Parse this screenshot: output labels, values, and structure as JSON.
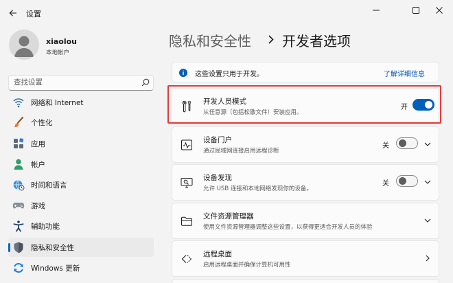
{
  "window": {
    "title": "设置",
    "buttons": [
      "minimize-icon",
      "maximize-icon",
      "close-icon"
    ]
  },
  "profile": {
    "name": "xiaolou",
    "account_type": "本地帐户"
  },
  "search": {
    "placeholder": "查找设置"
  },
  "sidebar": {
    "items": [
      {
        "label": "网络和 Internet",
        "icon": "network-icon"
      },
      {
        "label": "个性化",
        "icon": "brush-icon"
      },
      {
        "label": "应用",
        "icon": "apps-icon"
      },
      {
        "label": "帐户",
        "icon": "account-icon"
      },
      {
        "label": "时间和语言",
        "icon": "globe-clock-icon"
      },
      {
        "label": "游戏",
        "icon": "gamepad-icon"
      },
      {
        "label": "辅助功能",
        "icon": "accessibility-icon"
      },
      {
        "label": "隐私和安全性",
        "icon": "shield-icon",
        "selected": true
      },
      {
        "label": "Windows 更新",
        "icon": "update-icon"
      }
    ]
  },
  "header": {
    "parent": "隐私和安全性",
    "separator": "›",
    "current": "开发者选项"
  },
  "info_bar": {
    "text": "这些设置只用于开发。",
    "link": "了解详细信息"
  },
  "settings": [
    {
      "title": "开发人员模式",
      "desc": "从任意源（包括松散文件）安装应用。",
      "state": "开",
      "toggle_on": true,
      "expandable": false,
      "icon": "developer-tools-icon",
      "highlighted": true
    },
    {
      "title": "设备门户",
      "desc": "通过局域网连接启用远程诊断",
      "state": "关",
      "toggle_on": false,
      "expandable": true,
      "icon": "device-portal-icon"
    },
    {
      "title": "设备发现",
      "desc": "允许 USB 连接和本地网络发现你的设备。",
      "state": "关",
      "toggle_on": false,
      "expandable": true,
      "icon": "device-discovery-icon"
    },
    {
      "title": "文件资源管理器",
      "desc": "使用文件资源管理器调整这些设置，以获得更适合开发人员的体验",
      "expandable": true,
      "icon": "folder-icon"
    },
    {
      "title": "远程桌面",
      "desc": "启用远程桌面并确保计算机可用性",
      "navigate": true,
      "icon": "remote-desktop-icon"
    }
  ],
  "colors": {
    "accent": "#005fb8",
    "highlight_border": "#e03c3c",
    "link": "#0058b0",
    "background": "#f3f3f3",
    "card": "#fbfbfb"
  }
}
